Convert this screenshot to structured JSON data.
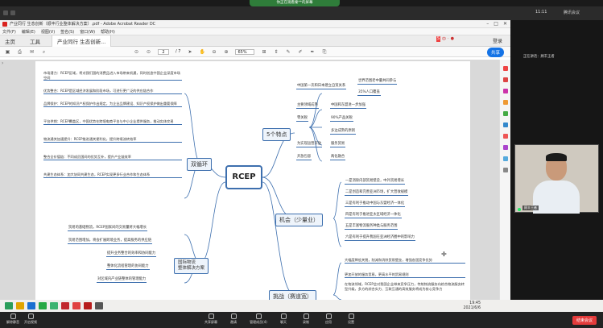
{
  "top_share_bar": {
    "text": "你正在观看秦**的屏幕"
  },
  "desktop": {
    "time": "11:11",
    "right_label": "腾讯会议"
  },
  "acrobat": {
    "title": "产业同行 生态创新（顺丰行业整体解决方案）.pdf - Adobe Acrobat Reader DC",
    "menu": [
      "文件(F)",
      "编辑(E)",
      "视图(V)",
      "签名(S)",
      "窗口(W)",
      "帮助(H)"
    ],
    "tabs": {
      "home": "主页",
      "tools": "工具",
      "doc": "产业同行 生态创新..."
    },
    "tab_right": "登录",
    "toolbar": {
      "page_value": "2",
      "page_total": "/ 7",
      "zoom": "65%",
      "share": "共享"
    }
  },
  "mindmap": {
    "center": "RCEP",
    "hubs": {
      "features": "5个特点",
      "double_cycle": "双循环",
      "opportunity": "机会（少量业）",
      "logistics": "国际物流\n整体解决方案",
      "challenge": "挑战（赛道宽）"
    },
    "features": [
      "中国第一次和日本建立自贸关系",
      "世界范围老中量共同参与",
      "35%人口覆盖",
      "主要领域成熟",
      "中国和东盟进一步加强",
      "零关税",
      "90%产品关税",
      "多边成熟的原则",
      "为实现运营开放",
      "开放包容",
      "服务贸易",
      "两化融合"
    ],
    "double_cycle": [
      "市场潜力：RCEP区域，将对我们国的消费品进入市场带来机遇，同时创造中国企业深度市场空间",
      "优势整合：RCEP是区域经济发展和阶段市场，可进行更广泛的供应链合作",
      "品牌保护：RCEP的知识产权保护作出规定，为企业品牌建设、知识产权保护做出重要保障",
      "平台供销：RCEP覆盖区，中国优势在跨境电商平台与中小企业提供服务，推动实体交易",
      "物流通关加速提升：RCEP推进通关便利化，提升跨境流转效率",
      "整合全价值链：不同成员国间的优势互补，提升产业链效率",
      "共建生态体系：加大协同共建生态，RCEP实现更多行业合作和生态体系"
    ],
    "opportunity": [
      "一是消除内部贸易壁垒，中外贸易增长",
      "二是创造和完善亚洲市场，扩大营收规模",
      "三是有利于推动中国与东盟经济一体化",
      "四是有利于推进亚太区域经济一体化",
      "五是丰富物流服务种类与服务范围",
      "六是有利于提升我国在亚洲经济圈中的影响力"
    ],
    "logistics": [
      "贸易的基础物流，RCEP国家间的交易量将大幅增长",
      "贸易范围增加，将会扩展跨境业务，提高服务的供应链",
      "提升业务整合的效率和协同能力",
      "整体化流程管理的协同能力",
      "对区域内产业链整体的管理能力"
    ],
    "challenge": [
      "大幅度降低关税，削减和消除贸易壁垒，增强各国竞争优势",
      "更加开放的服务贸易，更高水平的贸易规则",
      "在物流领域，RCEP会对我国企业带来竞争压力，传统物流服务向综合物流服务转型升级，多方的综合实力、互联互通的高效服务将成为核心竞争力"
    ]
  },
  "right_panel": {
    "label": "正在讲话：顾丰王者",
    "camera_label": "顾丰王者"
  },
  "taskbar": {
    "time": "19:45",
    "date": "2021/6/6"
  },
  "meeting_bar": {
    "items": [
      "解除静音",
      "开启视频",
      "共享屏幕",
      "邀请",
      "管理成员(4)",
      "聊天",
      "录制",
      "应用",
      "设置"
    ],
    "end": "结束会议"
  }
}
